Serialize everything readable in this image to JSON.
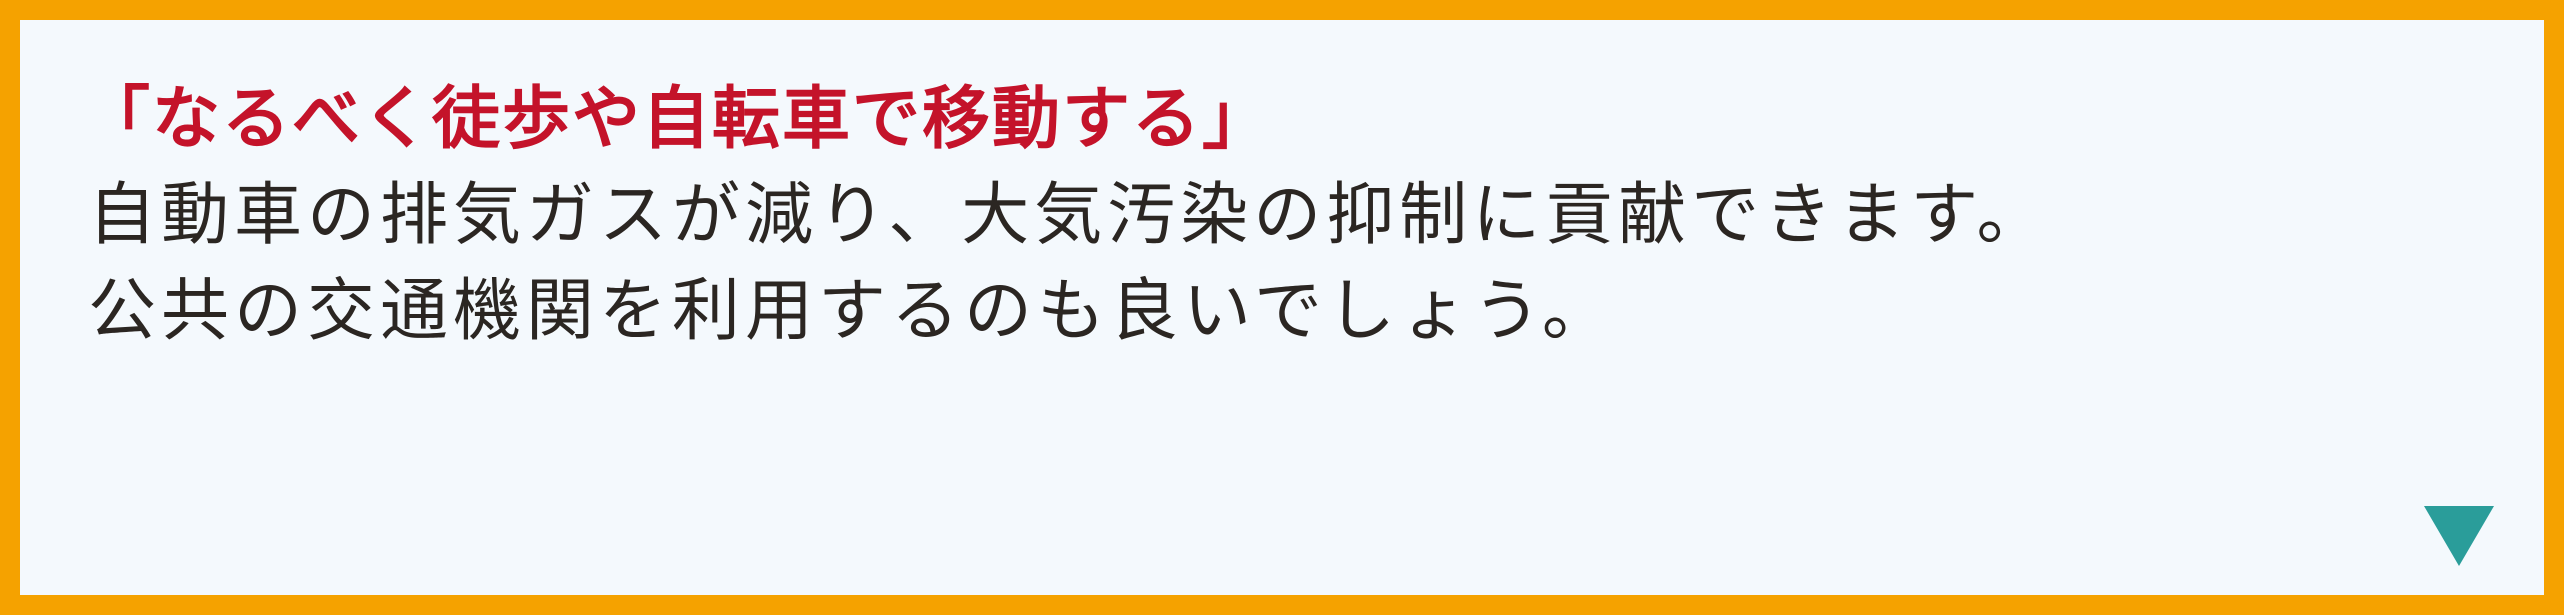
{
  "dialog": {
    "heading": "「なるべく徒歩や自転車で移動する」",
    "lines": [
      "自動車の排気ガスが減り、大気汚染の抑制に貢献できます。",
      "公共の交通機関を利用するのも良いでしょう。"
    ],
    "advance_icon": "down-triangle-icon"
  },
  "colors": {
    "frame": "#f5a200",
    "panel": "#f4f9fd",
    "heading": "#c4132a",
    "body_text": "#2b2622",
    "icon": "#2a9d9a"
  }
}
